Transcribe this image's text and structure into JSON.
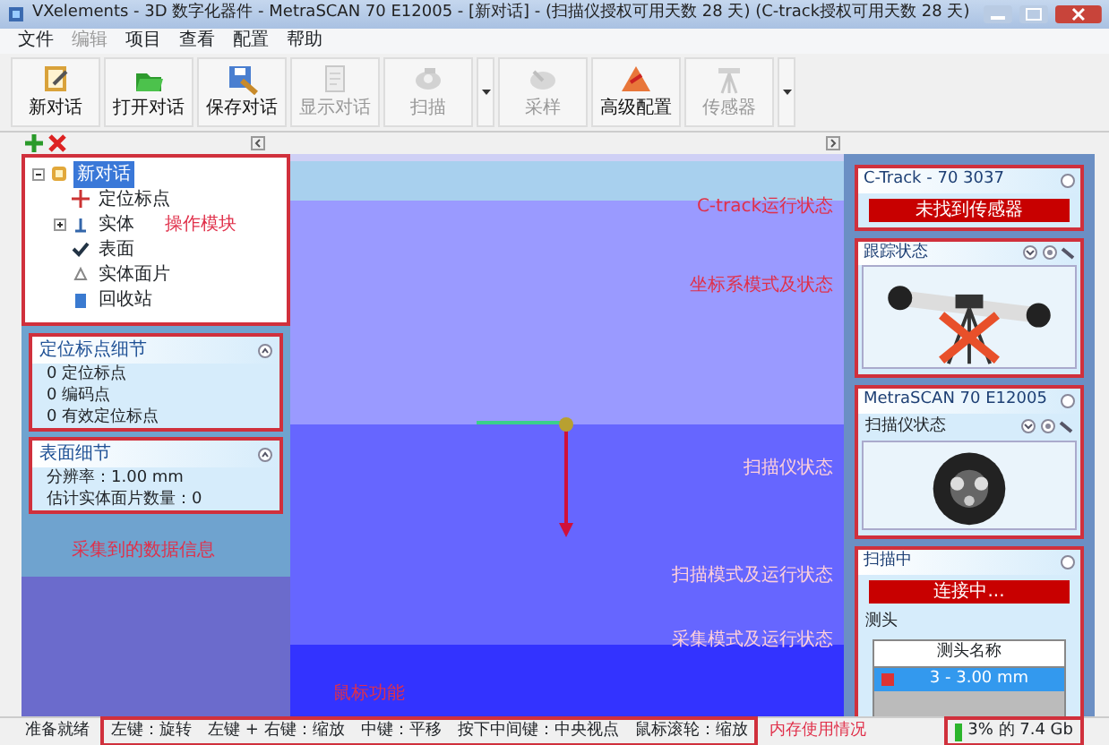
{
  "window": {
    "title": "VXelements - 3D 数字化器件 - MetraSCAN 70 E12005 - [新对话] - (扫描仪授权可用天数 28 天) (C-track授权可用天数 28 天)"
  },
  "menu": [
    {
      "label": "文件",
      "disabled": false
    },
    {
      "label": "编辑",
      "disabled": true
    },
    {
      "label": "项目",
      "disabled": false
    },
    {
      "label": "查看",
      "disabled": false
    },
    {
      "label": "配置",
      "disabled": false
    },
    {
      "label": "帮助",
      "disabled": false
    }
  ],
  "toolbar": [
    {
      "label": "新对话",
      "disabled": false,
      "dropdown": false
    },
    {
      "label": "打开对话",
      "disabled": false,
      "dropdown": false
    },
    {
      "label": "保存对话",
      "disabled": false,
      "dropdown": false
    },
    {
      "label": "显示对话",
      "disabled": true,
      "dropdown": false
    },
    {
      "label": "扫描",
      "disabled": true,
      "dropdown": true
    },
    {
      "label": "采样",
      "disabled": true,
      "dropdown": false
    },
    {
      "label": "高级配置",
      "disabled": false,
      "dropdown": false
    },
    {
      "label": "传感器",
      "disabled": true,
      "dropdown": true
    }
  ],
  "tree": {
    "label": "新对话",
    "selected": true,
    "children": [
      {
        "label": "定位标点",
        "selected": false,
        "collapsed": false
      },
      {
        "label": "实体",
        "selected": false,
        "collapsed": true
      },
      {
        "label": "表面",
        "selected": false,
        "collapsed": false
      },
      {
        "label": "实体面片",
        "selected": false,
        "collapsed": false
      },
      {
        "label": "回收站",
        "selected": false,
        "collapsed": false
      }
    ]
  },
  "detail_panels": [
    {
      "title": "定位标点细节",
      "lines": [
        "0 定位标点",
        "0 编码点",
        "0 有效定位标点"
      ]
    },
    {
      "title": "表面细节",
      "lines": [
        "分辨率：1.00 mm",
        "估计实体面片数量：0"
      ]
    }
  ],
  "left_annotations": [
    "操作模块",
    "采集到的数据信息"
  ],
  "viewport_annotations": [
    "C-track运行状态",
    "坐标系模式及状态",
    "扫描仪状态",
    "扫描模式及运行状态",
    "采集模式及运行状态",
    "鼠标功能"
  ],
  "right_panels": [
    {
      "kind": "status",
      "title": "C-Track - 70 3037",
      "status": "未找到传感器"
    },
    {
      "kind": "device",
      "title": "跟踪状态"
    },
    {
      "kind": "device",
      "title": "MetraSCAN 70 E12005",
      "subtitle": "扫描仪状态"
    },
    {
      "kind": "probe",
      "title": "扫描中",
      "status": "连接中...",
      "probe_label": "测头",
      "column": "测头名称",
      "rows": [
        {
          "name": "3 - 3.00 mm",
          "selected": true
        }
      ]
    }
  ],
  "status_bar": {
    "state": "准备就绪",
    "hints": [
      "左键：旋转",
      "左键 + 右键：缩放",
      "中键：平移",
      "按下中间键：中央视点",
      "鼠标滚轮：缩放"
    ],
    "memory": "3% 的 7.4 Gb",
    "memory_annotation": "内存使用情况"
  }
}
